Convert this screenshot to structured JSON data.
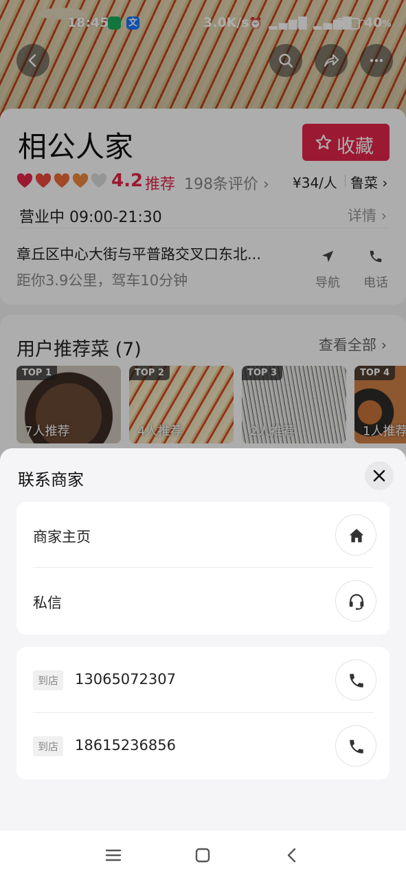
{
  "status_bar": {
    "time": "18:45",
    "speed": "3.0K/s",
    "battery": "40",
    "battery_unit": "%",
    "app2_icon": "文"
  },
  "shop": {
    "name": "相公人家",
    "favorite_label": "收藏",
    "score": "4.2",
    "recommend_label": "推荐",
    "reviews": "198条评价",
    "price": "¥34/人",
    "cuisine": "鲁菜",
    "hours": "营业中 09:00-21:30",
    "details_label": "详情",
    "address": "章丘区中心大街与平普路交叉口东北...",
    "distance": "距你3.9公里，驾车10分钟",
    "nav_label": "导航",
    "call_label": "电话",
    "hearts_filled": 4,
    "hearts_total": 5
  },
  "dishes": {
    "title": "用户推荐菜 (7)",
    "see_all": "查看全部",
    "items": [
      {
        "tag": "TOP 1",
        "count": "7人推荐"
      },
      {
        "tag": "TOP 2",
        "count": "4人推荐"
      },
      {
        "tag": "TOP 3",
        "count": "2人推荐"
      },
      {
        "tag": "TOP 4",
        "count": "1人推荐"
      }
    ]
  },
  "sheet": {
    "title": "联系商家",
    "home_label": "商家主页",
    "message_label": "私信",
    "phones": [
      {
        "chip": "到店",
        "number": "13065072307"
      },
      {
        "chip": "到店",
        "number": "18615236856"
      }
    ]
  },
  "colors": {
    "accent": "#e5264b"
  }
}
